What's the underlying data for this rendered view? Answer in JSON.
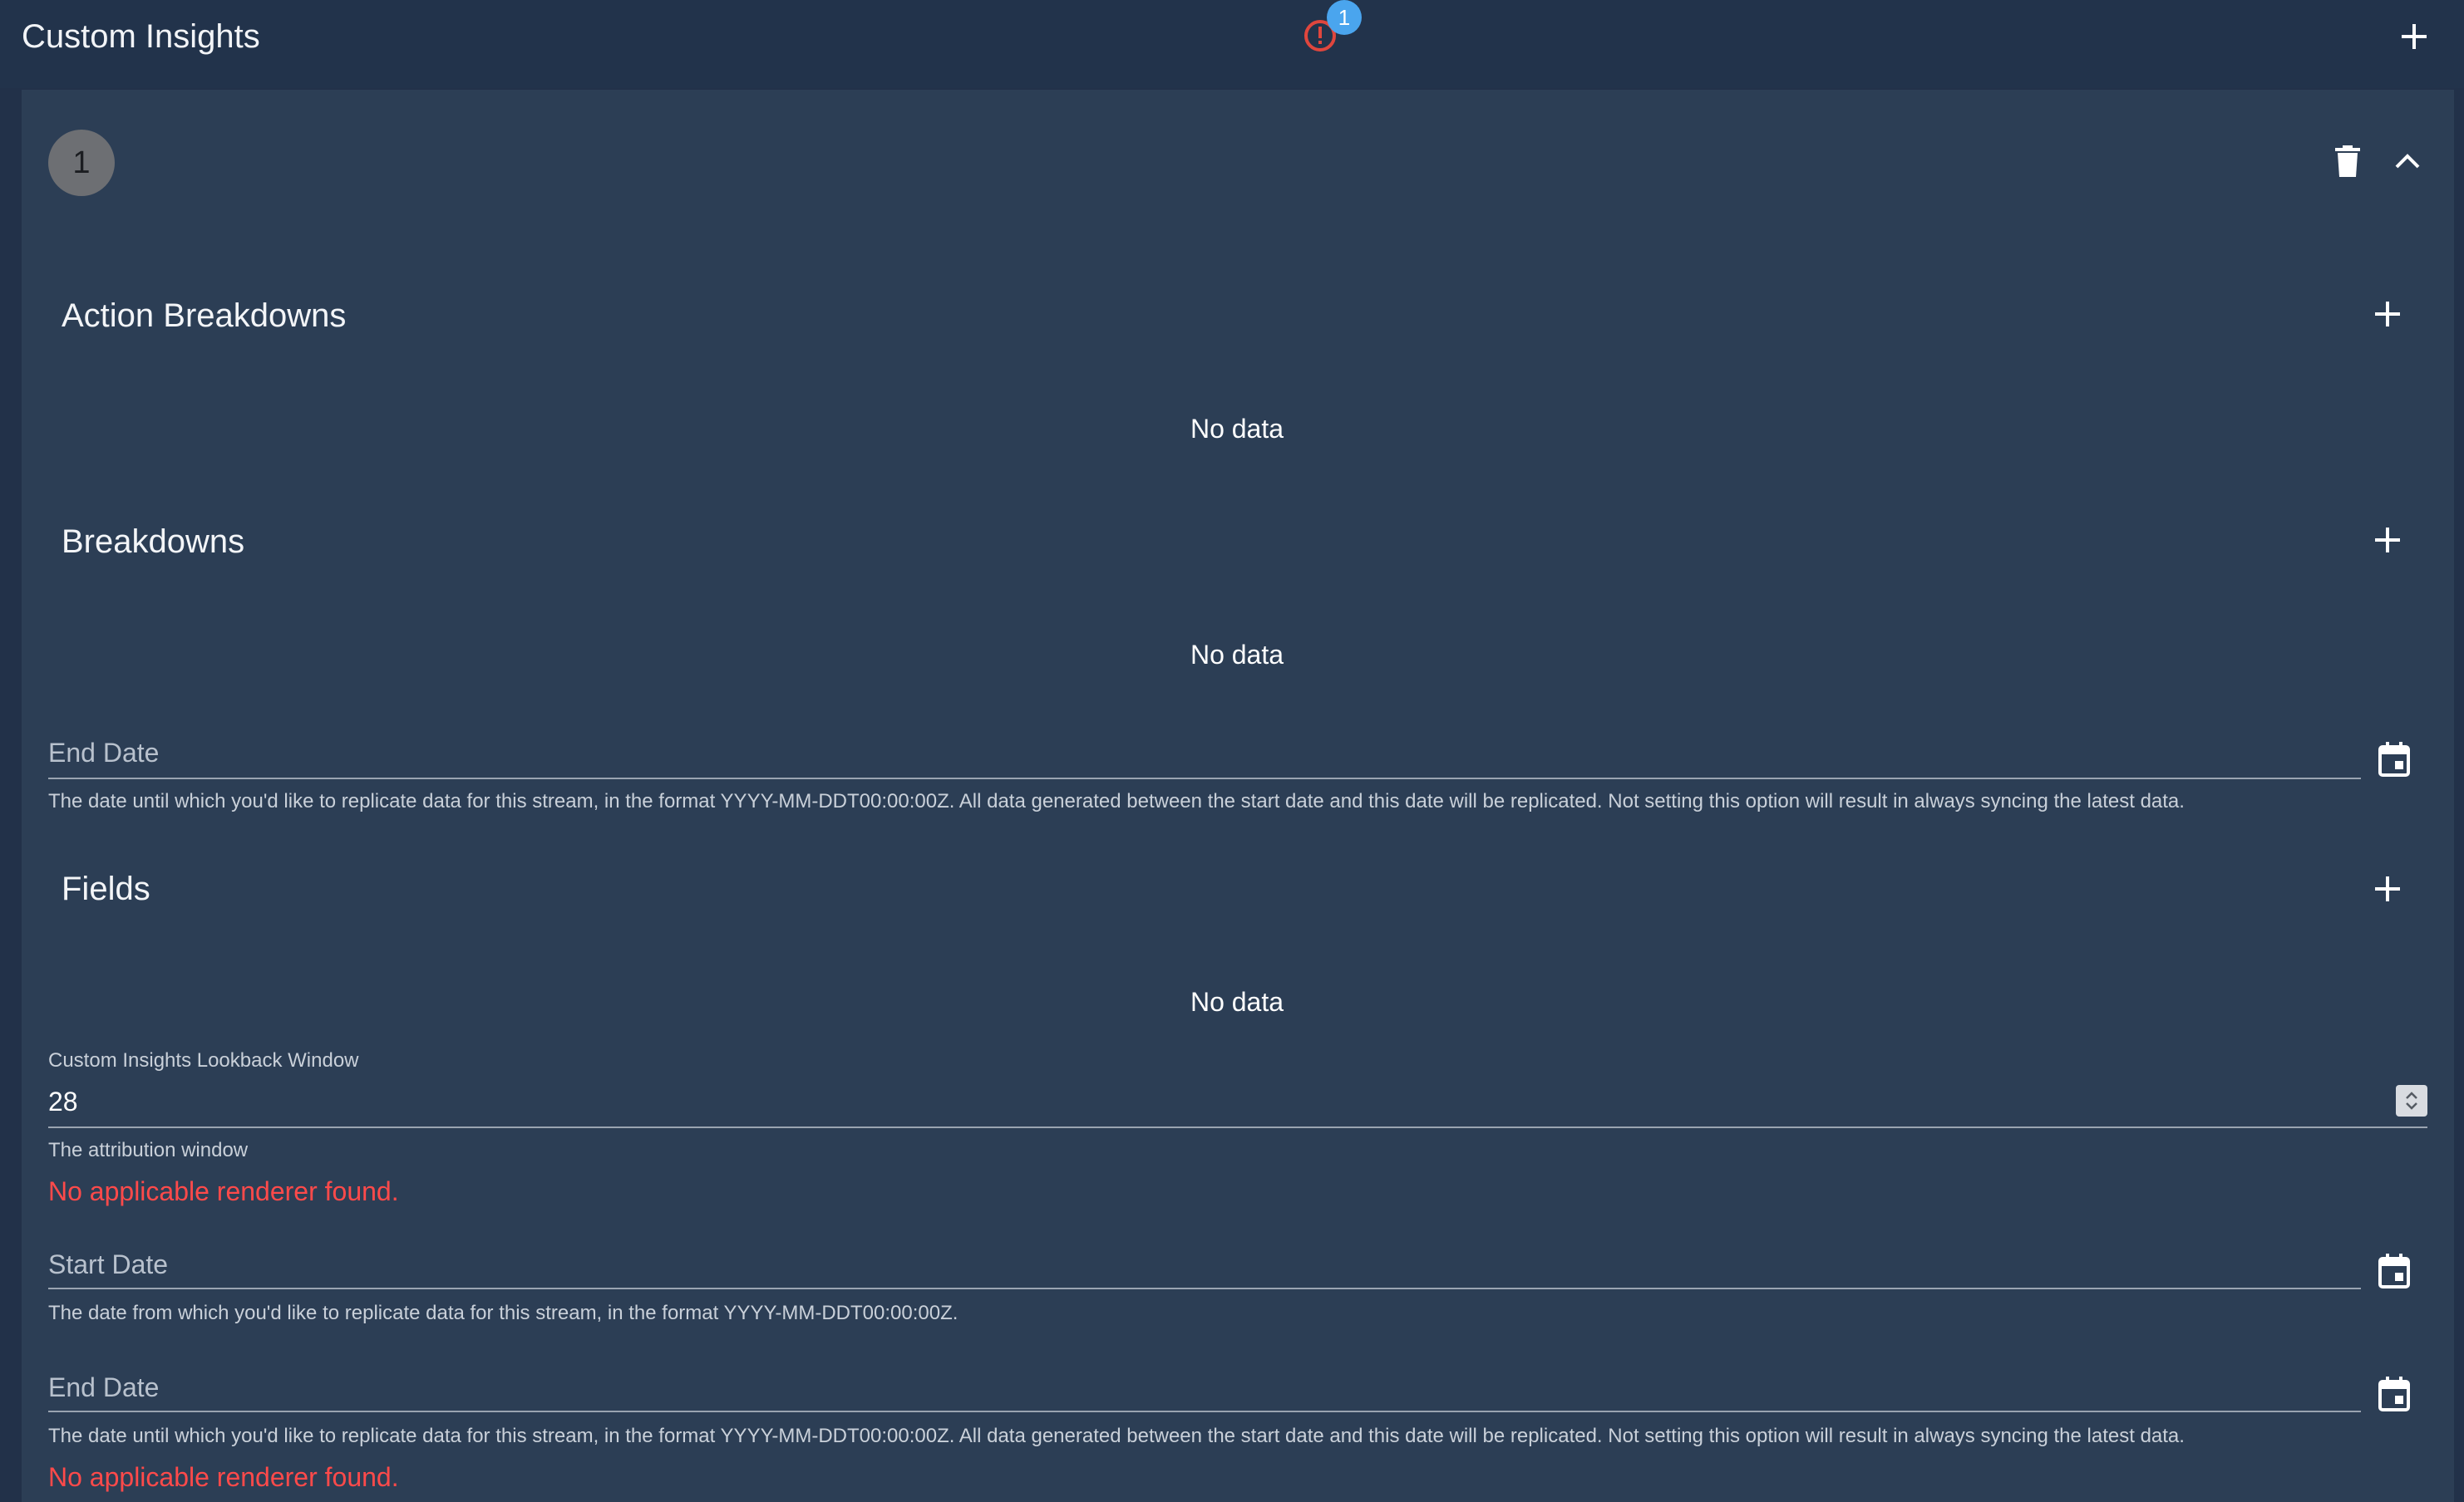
{
  "header": {
    "title": "Custom Insights",
    "alert_badge_count": "1",
    "alert_icon": "alert-circle-icon",
    "add_icon": "plus-icon"
  },
  "item": {
    "index": "1",
    "delete_icon": "trash-icon",
    "collapse_icon": "chevron-up-icon"
  },
  "sections": {
    "action_breakdowns": {
      "title": "Action Breakdowns",
      "empty": "No data"
    },
    "breakdowns": {
      "title": "Breakdowns",
      "empty": "No data"
    },
    "fields": {
      "title": "Fields",
      "empty": "No data"
    }
  },
  "end_date_1": {
    "label": "End Date",
    "helper": "The date until which you'd like to replicate data for this stream, in the format YYYY-MM-DDT00:00:00Z. All data generated between the start date and this date will be replicated. Not setting this option will result in always syncing the latest data."
  },
  "lookback": {
    "label": "Custom Insights Lookback Window",
    "value": "28",
    "helper": "The attribution window"
  },
  "error_1": "No applicable renderer found.",
  "start_date": {
    "label": "Start Date",
    "helper": "The date from which you'd like to replicate data for this stream, in the format YYYY-MM-DDT00:00:00Z."
  },
  "end_date_2": {
    "label": "End Date",
    "helper": "The date until which you'd like to replicate data for this stream, in the format YYYY-MM-DDT00:00:00Z. All data generated between the start date and this date will be replicated. Not setting this option will result in always syncing the latest data."
  },
  "error_2": "No applicable renderer found.",
  "colors": {
    "background": "#223149",
    "panel": "#2c3e55",
    "error": "#ff4a4a",
    "badge": "#4aa5ee",
    "alert": "#e0463d"
  }
}
